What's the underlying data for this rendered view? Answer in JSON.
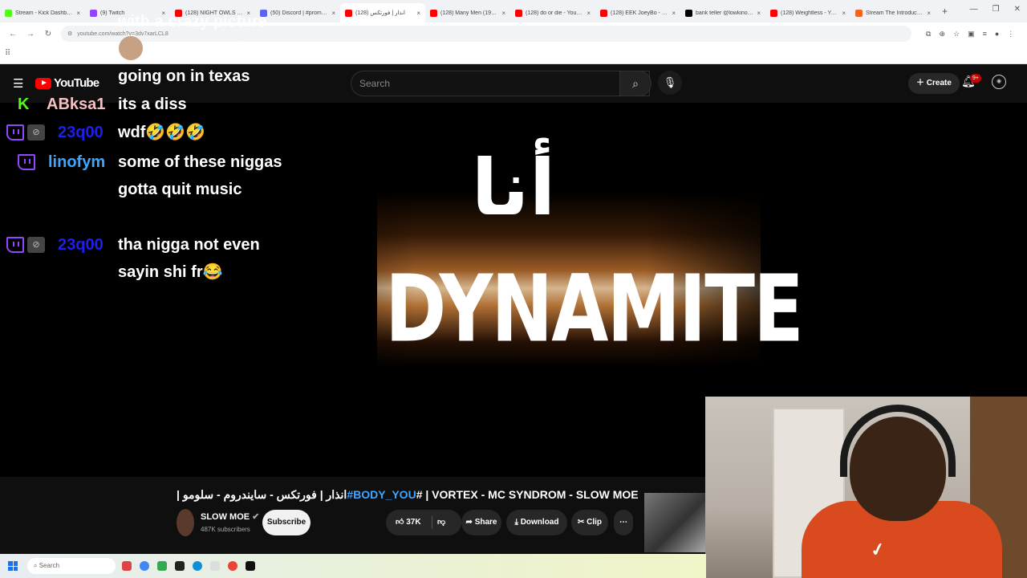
{
  "browser": {
    "tabs": [
      {
        "title": "Stream - Kick Dashboard",
        "color": "#53fc18"
      },
      {
        "title": "(9) Twitch",
        "color": "#9147ff"
      },
      {
        "title": "(128) NIGHT OWLS ONLY",
        "color": "#ff0000"
      },
      {
        "title": "(50) Discord | #promote-y",
        "color": "#5865f2"
      },
      {
        "title": "انذار | فورتكس (128)",
        "color": "#ff0000"
      },
      {
        "title": "(128) Many Men (1980s Gu",
        "color": "#ff0000"
      },
      {
        "title": "(128) do or die - YouTube",
        "color": "#ff0000"
      },
      {
        "title": "(128) EEK JoeyBo - 2100 G",
        "color": "#ff0000"
      },
      {
        "title": "bank teller @lowkino @lle",
        "color": "#000000"
      },
      {
        "title": "(128) Weightless - YouTub",
        "color": "#ff0000"
      },
      {
        "title": "Stream The Introduction b",
        "color": "#f26522"
      }
    ],
    "active_tab": 4,
    "url": "youtube.com/watch?v=3dv7xarLCL8"
  },
  "youtube": {
    "logo": "YouTube",
    "search_placeholder": "Search",
    "create_label": "Create",
    "notif_count": "9+"
  },
  "video": {
    "arabic_text": "أنا",
    "main_text": "DYNAMITE"
  },
  "chat": {
    "top_fragments": [
      "with a crazy picture",
      "what the helly"
    ],
    "rows": [
      {
        "user": "",
        "message": "going on in texas"
      },
      {
        "user": "ABksa1",
        "message": "its a diss",
        "platform": "kick",
        "color": "#f6c0c0"
      },
      {
        "user": "23q00",
        "message": "wdf🤣🤣🤣",
        "platform": "twitch",
        "color": "#1e1ef0"
      },
      {
        "user": "linofym",
        "message": "some of these niggas gotta quit music",
        "platform": "twitch",
        "color": "#3ea6ff"
      },
      {
        "user": "23q00",
        "message": "tha nigga not even sayin shi fr😂",
        "platform": "twitch",
        "color": "#1e1ef0"
      }
    ]
  },
  "video_info": {
    "title_prefix": "| انذار | فورتكس - سايندروم - سلومو",
    "hashtag": "#BODY_YOU",
    "title_suffix": "# | VORTEX - MC SYNDROM - SLOW MOE",
    "channel": "SLOW MOE",
    "subscribers": "487K subscribers",
    "subscribe": "Subscribe",
    "likes": "37K",
    "share": "Share",
    "download": "Download",
    "clip": "Clip"
  },
  "taskbar": {
    "search": "Search"
  }
}
